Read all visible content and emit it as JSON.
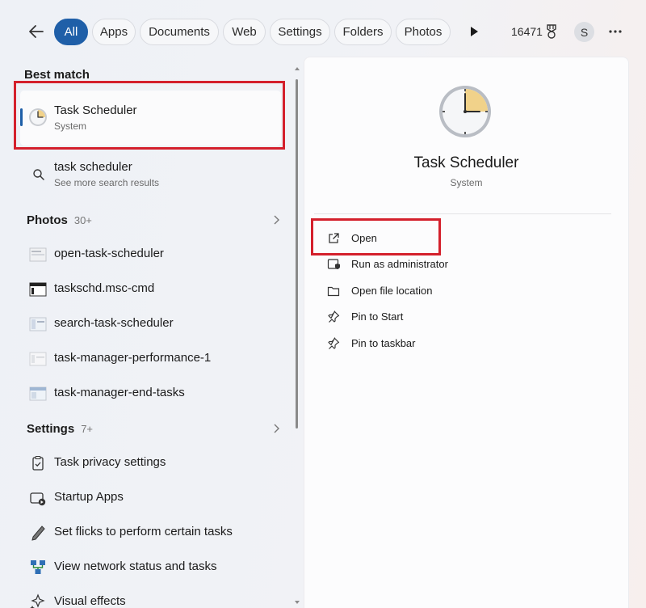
{
  "filters": {
    "tabs": [
      "All",
      "Apps",
      "Documents",
      "Web",
      "Settings",
      "Folders",
      "Photos"
    ],
    "points": "16471",
    "avatar_initial": "S"
  },
  "best_match": {
    "heading": "Best match",
    "title": "Task Scheduler",
    "subtitle": "System"
  },
  "web_search": {
    "title": "task scheduler",
    "subtitle": "See more search results"
  },
  "photos": {
    "heading": "Photos",
    "count": "30+",
    "items": [
      "open-task-scheduler",
      "taskschd.msc-cmd",
      "search-task-scheduler",
      "task-manager-performance-1",
      "task-manager-end-tasks"
    ]
  },
  "settings": {
    "heading": "Settings",
    "count": "7+",
    "items": [
      "Task privacy settings",
      "Startup Apps",
      "Set flicks to perform certain tasks",
      "View network status and tasks",
      "Visual effects"
    ]
  },
  "detail": {
    "title": "Task Scheduler",
    "subtitle": "System",
    "actions": [
      "Open",
      "Run as administrator",
      "Open file location",
      "Pin to Start",
      "Pin to taskbar"
    ]
  },
  "colors": {
    "accent": "#1f5fa8",
    "highlight": "#d4202c"
  }
}
